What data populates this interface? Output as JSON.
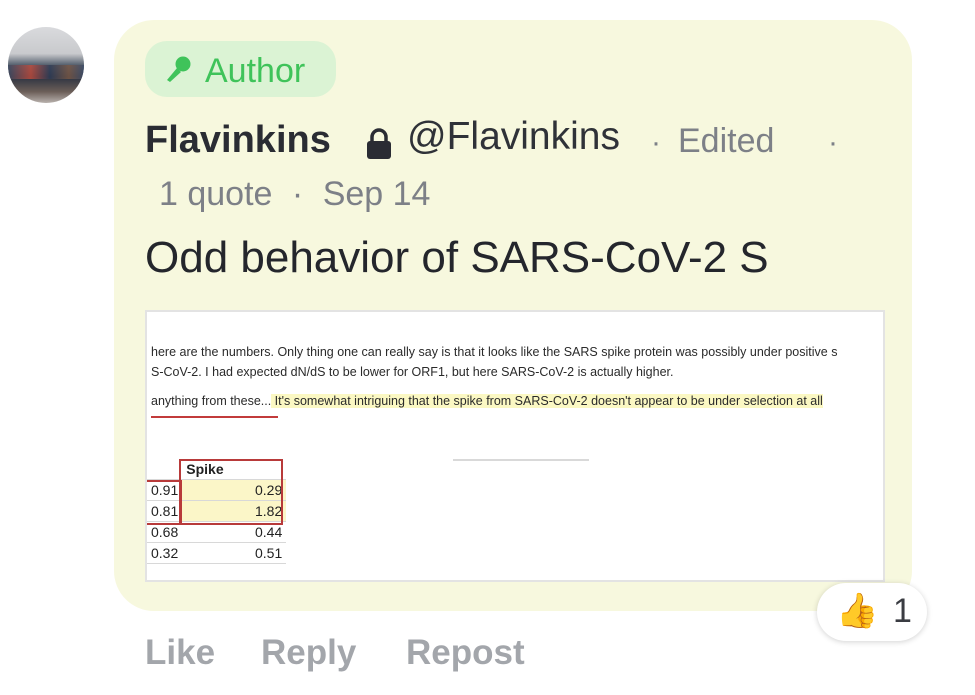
{
  "author": {
    "badge_label": "Author",
    "name": "Flavinkins",
    "handle": "@Flavinkins",
    "edited": "Edited",
    "quotes": "1 quote",
    "date": "Sep 14",
    "dot": "·"
  },
  "post": {
    "title": "Odd behavior of SARS-CoV-2 S",
    "image": {
      "line1": "here are the numbers. Only thing one can really say is that it looks like the SARS spike protein was possibly under positive s",
      "line2": "S-CoV-2. I had expected dN/dS to be lower for ORF1, but here SARS-CoV-2 is actually higher.",
      "line3_a": "anything from these...",
      "line3_b": " It's somewhat intriguing that the spike from SARS-CoV-2 doesn't appear to be under selection at all",
      "table": {
        "header": "Spike",
        "rows": [
          {
            "left": "0.91",
            "spike": "0.29"
          },
          {
            "left": "0.81",
            "spike": "1.82"
          },
          {
            "left": "0.68",
            "spike": "0.44"
          },
          {
            "left": "0.32",
            "spike": "0.51"
          }
        ]
      }
    }
  },
  "reaction": {
    "emoji": "👍",
    "count": "1"
  },
  "actions": {
    "like": "Like",
    "reply": "Reply",
    "repost": "Repost"
  },
  "colors": {
    "card_bg": "#f7f8de",
    "badge_bg": "#dbf3d4",
    "badge_text": "#3fc35a",
    "muted": "#7d8087"
  }
}
